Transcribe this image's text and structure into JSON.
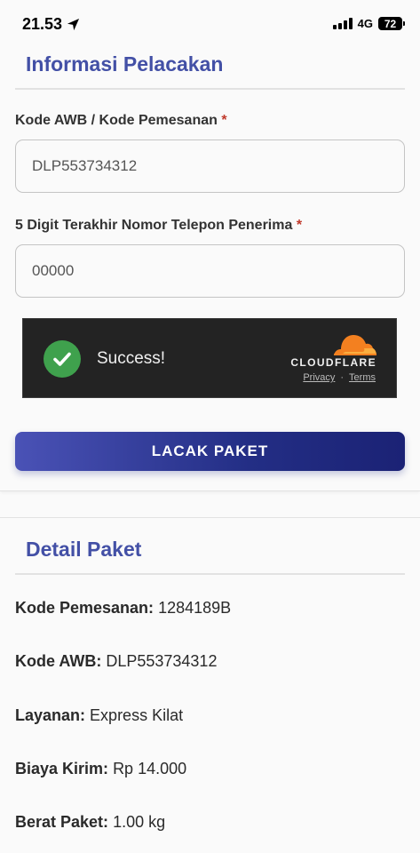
{
  "status_bar": {
    "time": "21.53",
    "network": "4G",
    "battery": "72"
  },
  "tracking": {
    "title": "Informasi Pelacakan",
    "awb_label": "Kode AWB / Kode Pemesanan",
    "awb_value": "DLP553734312",
    "phone_label": "5 Digit Terakhir Nomor Telepon Penerima",
    "phone_value": "00000",
    "required_mark": "*",
    "captcha": {
      "status": "Success!",
      "brand": "CLOUDFLARE",
      "privacy": "Privacy",
      "separator": "·",
      "terms": "Terms"
    },
    "submit_label": "LACAK PAKET"
  },
  "detail": {
    "title": "Detail Paket",
    "rows": [
      {
        "label": "Kode Pemesanan:",
        "value": "1284189B"
      },
      {
        "label": "Kode AWB:",
        "value": "DLP553734312"
      },
      {
        "label": "Layanan:",
        "value": "Express Kilat"
      },
      {
        "label": "Biaya Kirim:",
        "value": "Rp 14.000"
      },
      {
        "label": "Berat Paket:",
        "value": "1.00 kg"
      }
    ]
  },
  "colors": {
    "accent": "#4350a6",
    "button_start": "#4a52b6",
    "button_end": "#1b2275",
    "required": "#c0392b",
    "success": "#3fa14d",
    "cloudflare_orange": "#f38020"
  }
}
